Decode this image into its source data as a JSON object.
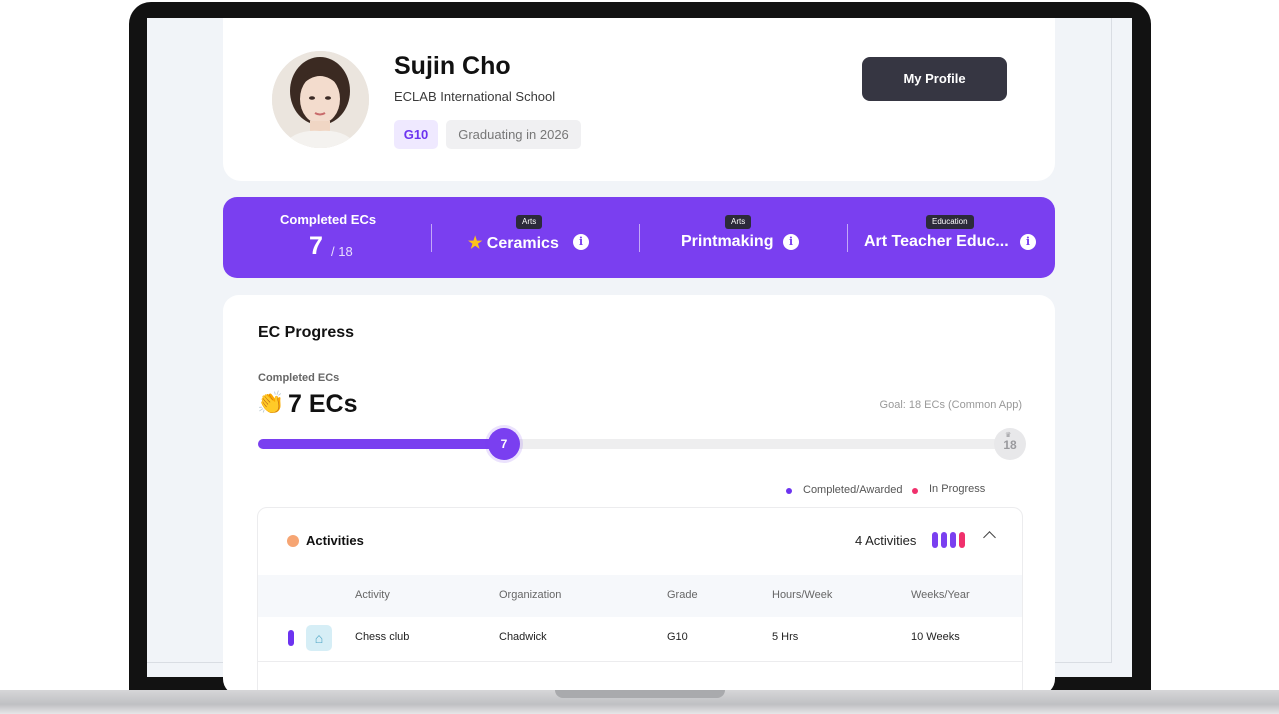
{
  "profile": {
    "name": "Sujin Cho",
    "school": "ECLAB International School",
    "grade": "G10",
    "graduation": "Graduating in 2026",
    "profile_button": "My Profile"
  },
  "stats": {
    "completed_label": "Completed ECs",
    "completed_value": "7",
    "completed_total": "/ 18",
    "ecs": [
      {
        "category": "Arts",
        "name": "Ceramics",
        "starred": true
      },
      {
        "category": "Arts",
        "name": "Printmaking",
        "starred": false
      },
      {
        "category": "Education",
        "name": "Art Teacher Educ...",
        "starred": false
      }
    ]
  },
  "progress": {
    "title": "EC Progress",
    "completed_label": "Completed ECs",
    "count_text": "7 ECs",
    "goal_text": "Goal: 18 ECs (Common App)",
    "current": 7,
    "goal": 18,
    "current_label": "7",
    "goal_label": "18",
    "legend": [
      {
        "label": "Completed/Awarded",
        "color": "#6c33f0"
      },
      {
        "label": "In Progress",
        "color": "#f0306c"
      }
    ]
  },
  "activities": {
    "title": "Activities",
    "count_text": "4 Activities",
    "bar_colors": [
      "#7a3ff0",
      "#7a3ff0",
      "#7a3ff0",
      "#f0306c"
    ],
    "columns": [
      "Activity",
      "Organization",
      "Grade",
      "Hours/Week",
      "Weeks/Year"
    ],
    "rows": [
      {
        "activity": "Chess club",
        "organization": "Chadwick",
        "grade": "G10",
        "hours": "5 Hrs",
        "weeks": "10 Weeks",
        "icon": "school-building-icon"
      }
    ]
  },
  "colors": {
    "accent": "#7a3ff0",
    "in_progress": "#f0306c",
    "dark_button": "#363642"
  }
}
